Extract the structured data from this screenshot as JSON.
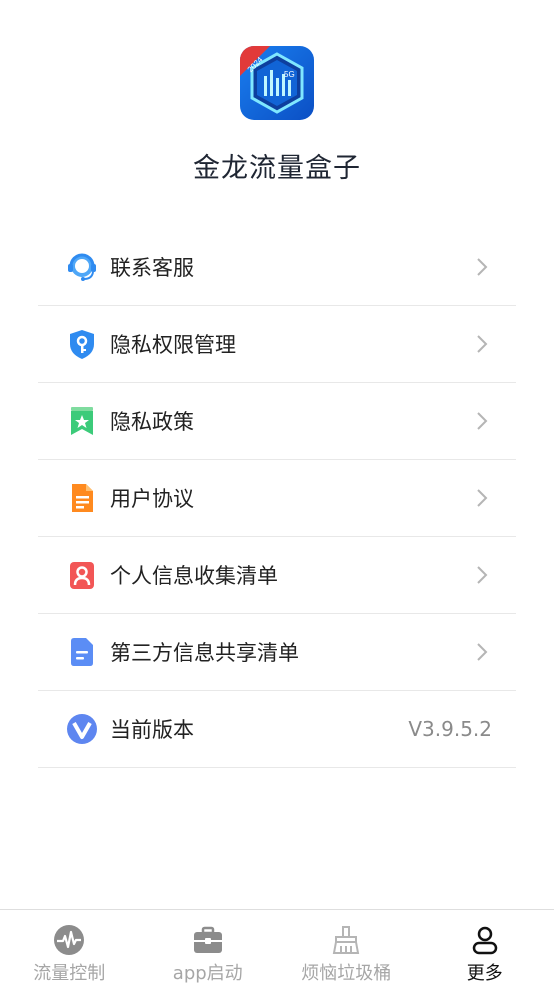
{
  "header": {
    "app_name": "金龙流量盒子",
    "logo_badge": "2024",
    "logo_tag": "5G"
  },
  "menu": [
    {
      "label": "联系客服",
      "icon": "customer-service-icon"
    },
    {
      "label": "隐私权限管理",
      "icon": "shield-key-icon"
    },
    {
      "label": "隐私政策",
      "icon": "bookmark-star-icon"
    },
    {
      "label": "用户协议",
      "icon": "document-icon"
    },
    {
      "label": "个人信息收集清单",
      "icon": "person-card-icon"
    },
    {
      "label": "第三方信息共享清单",
      "icon": "file-icon"
    },
    {
      "label": "当前版本",
      "icon": "version-v-icon",
      "value": "V3.9.5.2"
    }
  ],
  "tabbar": {
    "tabs": [
      {
        "label": "流量控制",
        "icon": "pulse-icon",
        "active": false
      },
      {
        "label": "app启动",
        "icon": "briefcase-icon",
        "active": false
      },
      {
        "label": "烦恼垃圾桶",
        "icon": "broom-icon",
        "active": false
      },
      {
        "label": "更多",
        "icon": "person-icon",
        "active": true
      }
    ]
  },
  "colors": {
    "accent_blue": "#2f8bf0",
    "active_tab": "#111111",
    "inactive_tab": "#a6a6a6",
    "divider": "#e8e8e8"
  }
}
